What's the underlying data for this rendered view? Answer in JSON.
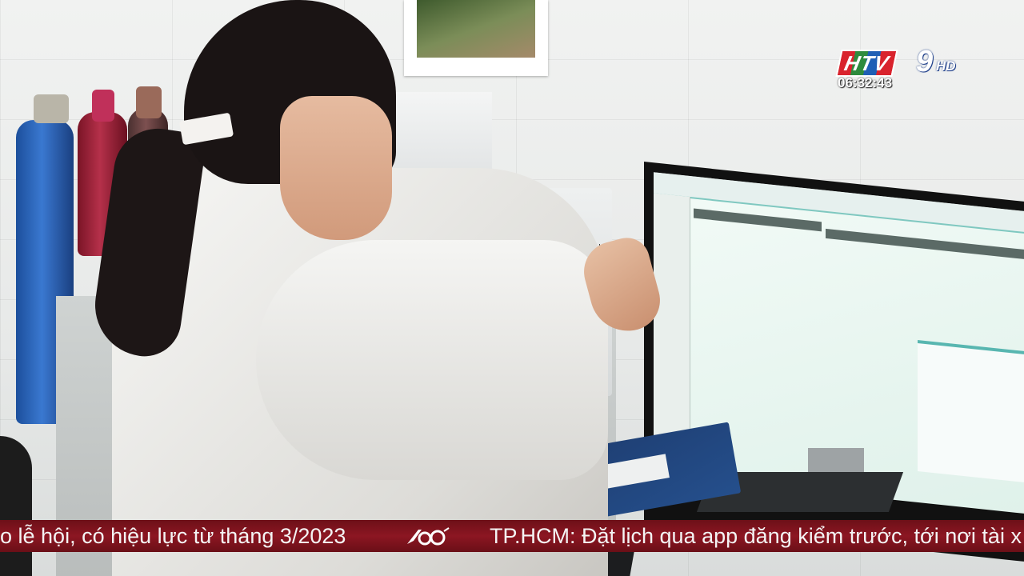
{
  "broadcast": {
    "channel_logo": "HTV9HD",
    "clock": "06:32:43",
    "ticker": {
      "left_text": "o lễ hội, có hiệu lực từ tháng 3/2023",
      "right_text": "TP.HCM: Đặt lịch qua app đăng kiểm trước, tới nơi tài x",
      "separator_icon": "htv-60-anniversary-icon"
    }
  },
  "colors": {
    "ticker_background": "#8c1622",
    "logo_red": "#d9232d",
    "logo_green": "#2e8b3d",
    "logo_blue": "#1f5fb5"
  }
}
